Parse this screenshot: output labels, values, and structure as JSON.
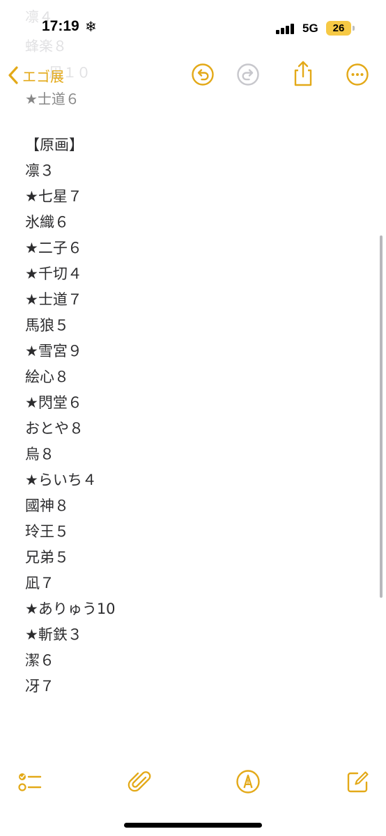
{
  "status_bar": {
    "time": "17:19",
    "network": "5G",
    "battery": "26"
  },
  "nav": {
    "back_label": "エゴ展"
  },
  "scrolled_lines": [
    "凛４",
    "蜂楽８",
    "凪１０",
    "★士道６"
  ],
  "note": {
    "lines": [
      "【原画】",
      "凛３",
      "★七星７",
      "氷織６",
      "★二子６",
      "★千切４",
      "★士道７",
      "馬狼５",
      "★雪宮９",
      "絵心８",
      "★閃堂６",
      "おとや８",
      "烏８",
      "★らいち４",
      "國神８",
      "玲王５",
      "兄弟５",
      "凪７",
      "★ありゅう10",
      "★斬鉄３",
      "潔６",
      "冴７"
    ]
  },
  "colors": {
    "accent": "#e3a918",
    "text": "#1c1c1e"
  },
  "icons": {
    "back": "chevron-left-icon",
    "undo": "undo-icon",
    "redo": "redo-icon",
    "share": "share-icon",
    "more": "more-icon",
    "checklist": "checklist-icon",
    "attachment": "paperclip-icon",
    "markup": "pen-tip-icon",
    "compose": "compose-icon"
  }
}
